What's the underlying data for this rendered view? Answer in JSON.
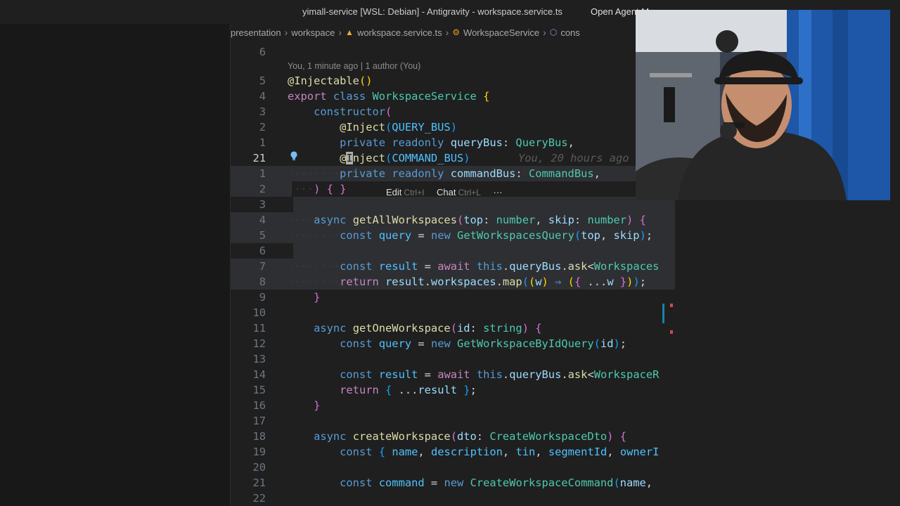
{
  "window": {
    "title": "yimall-service [WSL: Debian] - Antigravity - workspace.service.ts",
    "open_agent_label": "Open Agent M"
  },
  "breadcrumb": [
    {
      "label": "presentation",
      "icon": "folder-icon"
    },
    {
      "label": "workspace",
      "icon": "folder-icon"
    },
    {
      "label": "workspace.service.ts",
      "icon": "angular-file-icon"
    },
    {
      "label": "WorkspaceService",
      "icon": "class-icon"
    },
    {
      "label": "cons",
      "icon": "cube-icon"
    }
  ],
  "editor": {
    "codelens": "You, 1 minute ago | 1 author (You)",
    "blame": "You, 20 hours ago",
    "inline_actions": {
      "edit_label": "Edit",
      "edit_shortcut": "Ctrl+I",
      "chat_label": "Chat",
      "chat_shortcut": "Ctrl+L",
      "more_label": "···"
    },
    "line_numbers": [
      "6",
      "5",
      "4",
      "3",
      "2",
      "1",
      "21",
      "1",
      "2",
      "3",
      "4",
      "5",
      "6",
      "7",
      "8",
      "9",
      "10",
      "11",
      "12",
      "13",
      "14",
      "15",
      "16",
      "17",
      "18",
      "19",
      "20",
      "21",
      "22"
    ]
  },
  "colors": {
    "background": "#1f1f1f",
    "keyword": "#569cd6",
    "class": "#4ec9b0",
    "function": "#dcdcaa",
    "variable": "#9cdcfe"
  },
  "webcam": {
    "description_icon": "webcam-overlay"
  }
}
